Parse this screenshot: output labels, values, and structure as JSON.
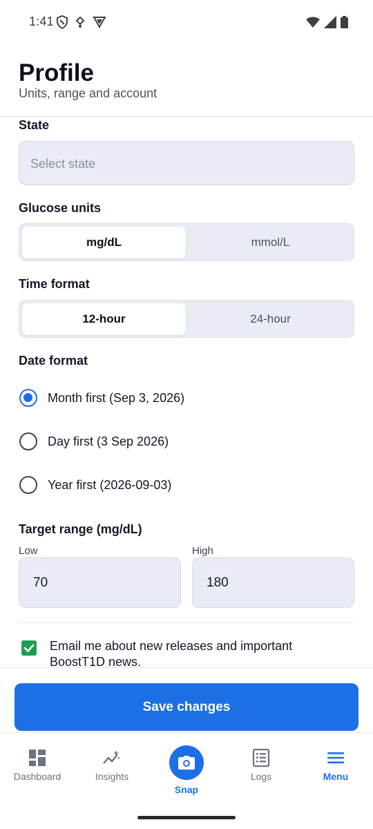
{
  "status_bar": {
    "time": "1:41",
    "left_icons": [
      "shield-icon",
      "location-icon",
      "vpn-icon"
    ],
    "right_icons": [
      "wifi-icon",
      "signal-icon",
      "battery-icon"
    ]
  },
  "header": {
    "title": "Profile",
    "subtitle": "Units, range and account"
  },
  "state": {
    "label": "State",
    "placeholder": "Select state"
  },
  "glucose_units": {
    "label": "Glucose units",
    "options": [
      "mg/dL",
      "mmol/L"
    ],
    "selected": "mg/dL"
  },
  "time_format": {
    "label": "Time format",
    "options": [
      "12-hour",
      "24-hour"
    ],
    "selected": "12-hour"
  },
  "date_format": {
    "label": "Date format",
    "options": [
      {
        "label": "Month first (Sep 3, 2026)",
        "checked": true
      },
      {
        "label": "Day first (3 Sep 2026)",
        "checked": false
      },
      {
        "label": "Year first (2026-09-03)",
        "checked": false
      }
    ]
  },
  "target_range": {
    "label": "Target range (mg/dL)",
    "low_label": "Low",
    "low_value": "70",
    "high_label": "High",
    "high_value": "180"
  },
  "email_opt_in": {
    "checked": true,
    "text": "Email me about new releases and important BoostT1D news."
  },
  "save_button": {
    "label": "Save changes"
  },
  "bottom_nav": {
    "items": [
      {
        "label": "Dashboard",
        "icon": "dashboard-icon",
        "active": false
      },
      {
        "label": "Insights",
        "icon": "insights-icon",
        "active": false
      },
      {
        "label": "Snap",
        "icon": "camera-icon",
        "active": false
      },
      {
        "label": "Logs",
        "icon": "logs-icon",
        "active": false
      },
      {
        "label": "Menu",
        "icon": "menu-icon",
        "active": true
      }
    ]
  },
  "colors": {
    "accent": "#1d6fe6",
    "checkbox": "#1e9e55",
    "field_bg": "#e9ecf4"
  }
}
